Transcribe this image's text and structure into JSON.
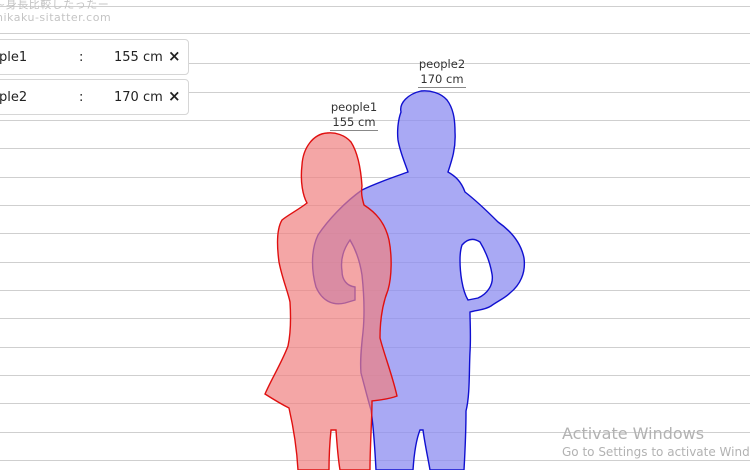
{
  "site": {
    "title_jp": "~身長比較したったー",
    "title_url": "hikaku-sitatter.com"
  },
  "entries": [
    {
      "name": "ple1",
      "separator": ":",
      "height": "155 cm",
      "remove": "×"
    },
    {
      "name": "ple2",
      "separator": ":",
      "height": "170 cm",
      "remove": "×"
    }
  ],
  "figures": [
    {
      "name": "people1",
      "height": "155 cm",
      "fill": "#f08080",
      "stroke": "#e01010"
    },
    {
      "name": "people2",
      "height": "170 cm",
      "fill": "#8c8cf0",
      "stroke": "#1010d0"
    }
  ],
  "watermark": {
    "line1": "Activate Windows",
    "line2": "Go to Settings to activate Windows."
  }
}
